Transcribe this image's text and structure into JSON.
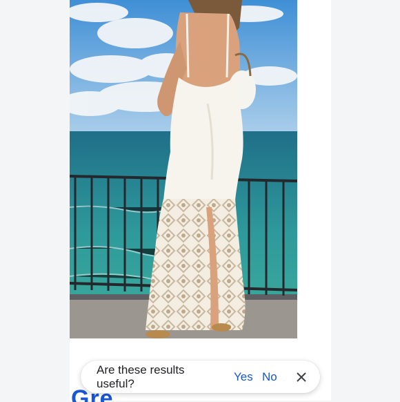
{
  "feedback": {
    "question": "Are these results useful?",
    "yes_label": "Yes",
    "no_label": "No",
    "close_icon": "close-icon"
  },
  "partial_heading": "Gre",
  "colors": {
    "link": "#1a56c8",
    "heading": "#1a57d6",
    "background": "#f4f5f6"
  }
}
